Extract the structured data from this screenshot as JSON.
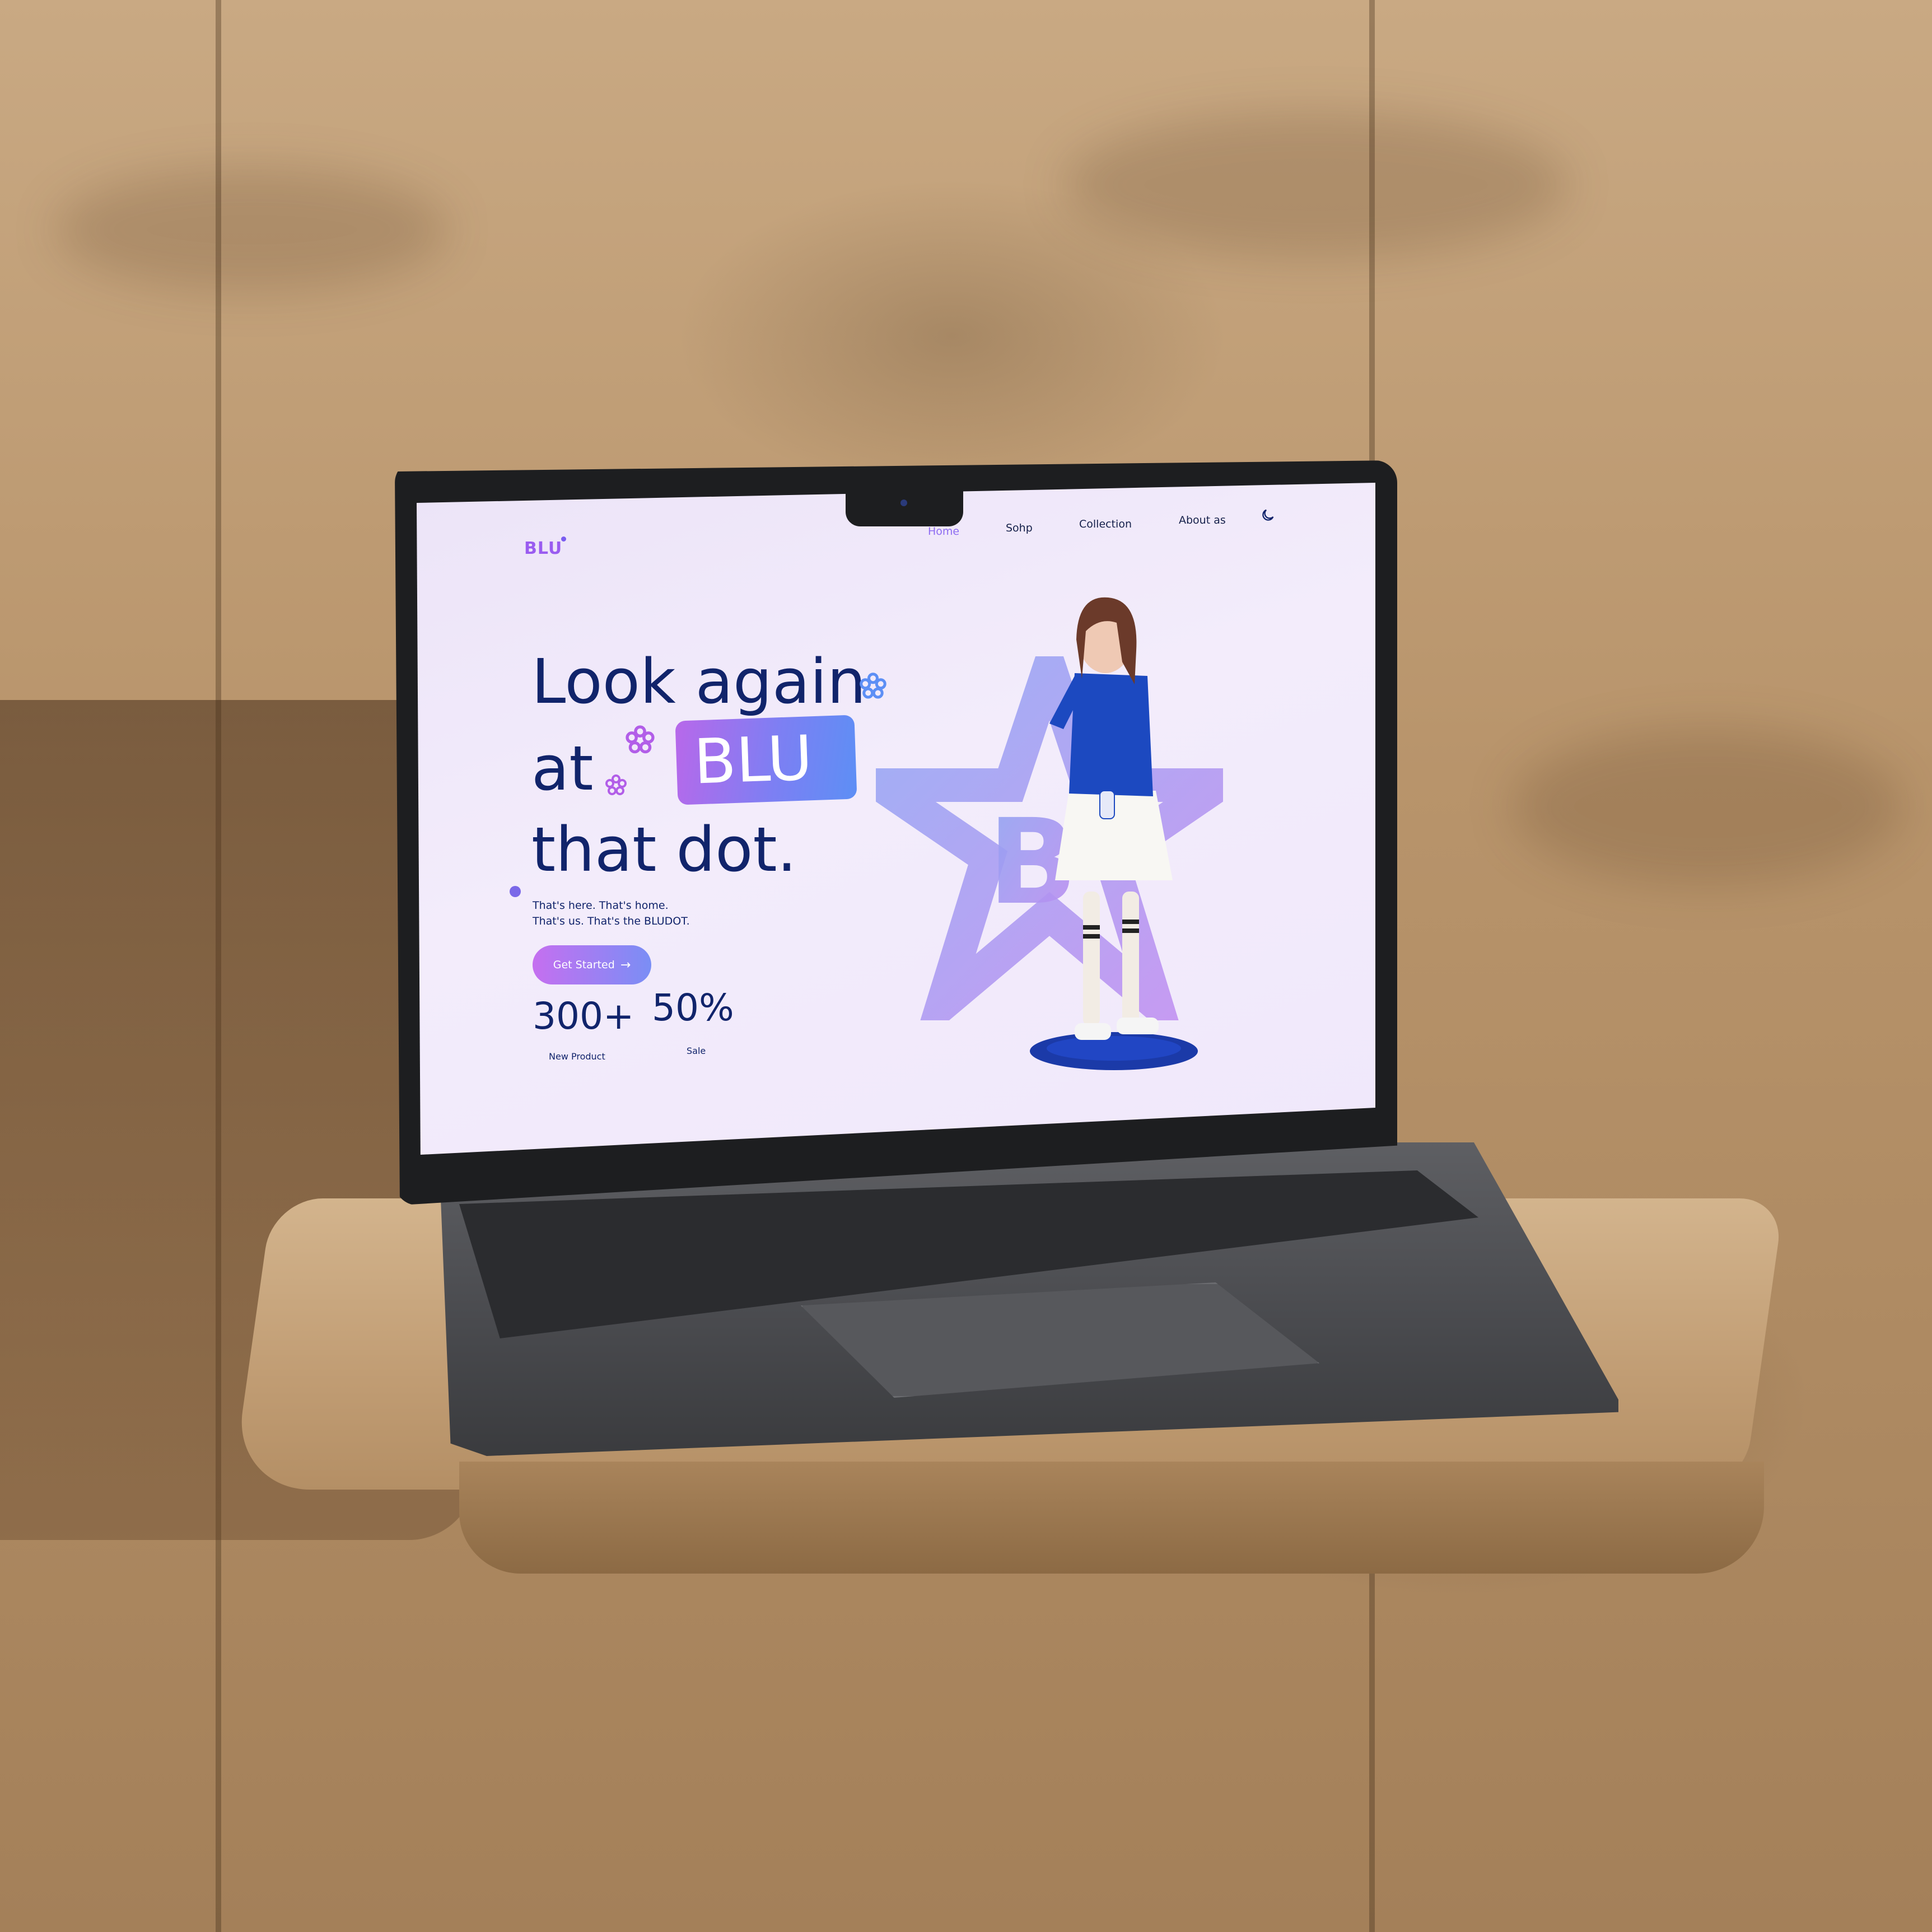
{
  "site": {
    "logo": "BLU",
    "nav": {
      "home": "Home",
      "shop": "Sohp",
      "collection": "Collection",
      "about": "About as"
    },
    "theme_toggle_icon": "moon-icon"
  },
  "hero": {
    "line1": "Look again",
    "line2_prefix": "at",
    "highlight": "BLU",
    "line3": "that dot.",
    "tagline_1": "That's here. That's home.",
    "tagline_2": "That's us. That's the BLUDOT.",
    "cta_label": "Get Started",
    "cta_icon": "arrow-right-icon"
  },
  "stats": [
    {
      "value": "300+",
      "label": "New Product"
    },
    {
      "value": "50%",
      "label": "Sale"
    }
  ],
  "colors": {
    "primary_text": "#11246b",
    "accent_purple": "#9a5cf0",
    "accent_blue": "#5d8ff5",
    "background": "#f0e8fb"
  }
}
